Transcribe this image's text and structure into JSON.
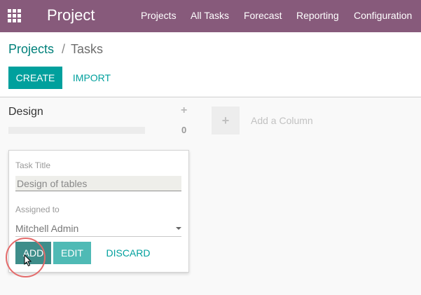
{
  "app": {
    "title": "Project",
    "menu": [
      "Projects",
      "All Tasks",
      "Forecast",
      "Reporting",
      "Configuration"
    ]
  },
  "breadcrumb": {
    "parent": "Projects",
    "separator": "/",
    "current": "Tasks"
  },
  "toolbar": {
    "create_label": "CREATE",
    "import_label": "IMPORT"
  },
  "column": {
    "title": "Design",
    "count": "0",
    "progress": 0,
    "add_icon": "plus-icon"
  },
  "add_column": {
    "label": "Add a Column",
    "icon": "plus-icon"
  },
  "quick_create": {
    "task_title_label": "Task Title",
    "task_title_value": "Design of tables",
    "assigned_label": "Assigned to",
    "assigned_value": "Mitchell Admin",
    "add_label": "ADD",
    "edit_label": "EDIT",
    "discard_label": "DISCARD"
  },
  "colors": {
    "brand": "#875a7b",
    "primary": "#00a09d",
    "link": "#00807a",
    "highlight_ring": "#e46b6b"
  }
}
